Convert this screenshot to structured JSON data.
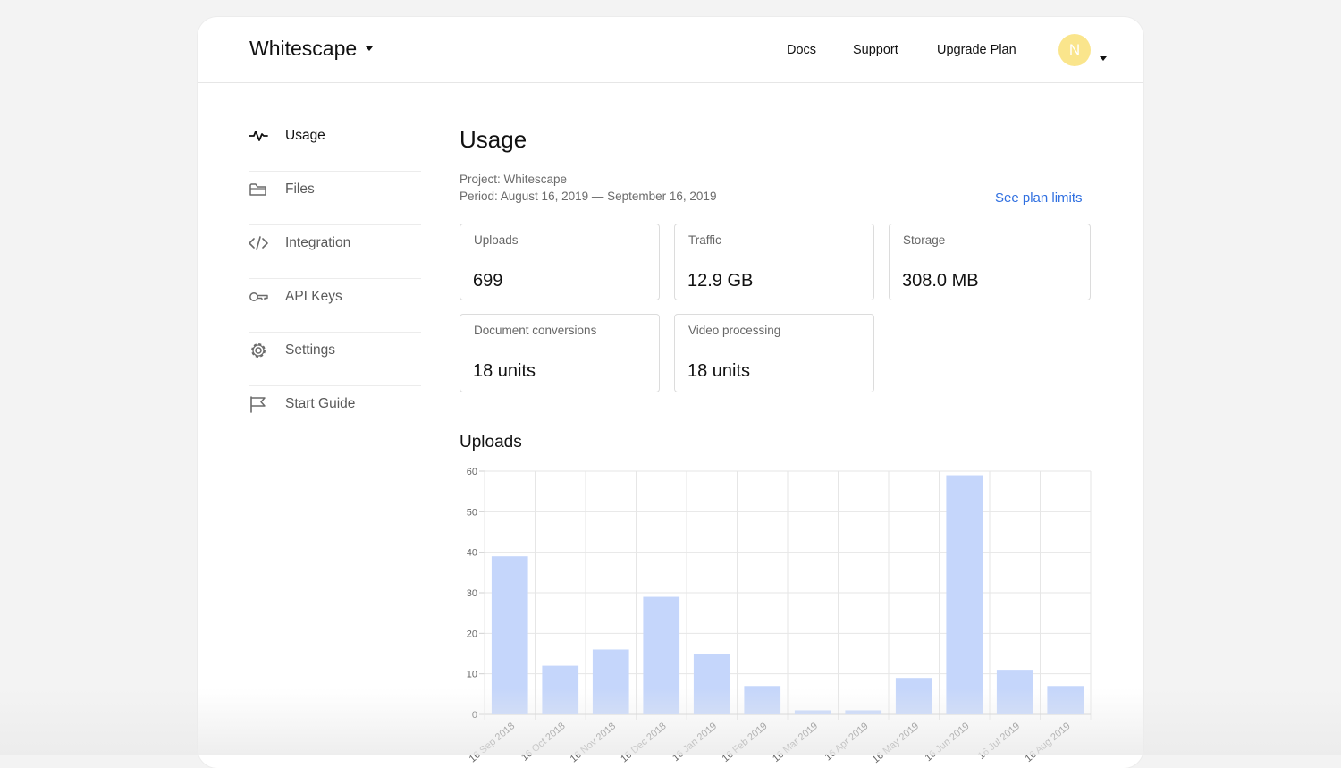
{
  "header": {
    "brand": "Whitescape",
    "links": [
      "Docs",
      "Support",
      "Upgrade Plan"
    ],
    "avatar_initial": "N",
    "avatar_color": "#fae58c"
  },
  "sidebar": {
    "items": [
      {
        "label": "Usage",
        "icon": "activity-icon",
        "active": true
      },
      {
        "label": "Files",
        "icon": "folder-icon",
        "active": false
      },
      {
        "label": "Integration",
        "icon": "code-icon",
        "active": false
      },
      {
        "label": "API Keys",
        "icon": "key-icon",
        "active": false
      },
      {
        "label": "Settings",
        "icon": "gear-icon",
        "active": false
      },
      {
        "label": "Start Guide",
        "icon": "flag-icon",
        "active": false
      }
    ]
  },
  "main": {
    "title": "Usage",
    "project": "Project: Whitescape",
    "period": "Period: August 16, 2019 — September 16, 2019",
    "plan_link": "See plan limits",
    "link_color": "#2f6fe0",
    "stats": [
      {
        "label": "Uploads",
        "value": "699"
      },
      {
        "label": "Traffic",
        "value": "12.9 GB"
      },
      {
        "label": "Storage",
        "value": "308.0 MB"
      },
      {
        "label": "Document conversions",
        "value": "18 units"
      },
      {
        "label": "Video processing",
        "value": "18 units"
      }
    ],
    "chart_heading": "Uploads"
  },
  "chart_data": {
    "type": "bar",
    "title": "Uploads",
    "categories": [
      "16 Sep 2018",
      "16 Oct 2018",
      "16 Nov 2018",
      "16 Dec 2018",
      "16 Jan 2019",
      "16 Feb 2019",
      "16 Mar 2019",
      "16 Apr 2019",
      "16 May 2019",
      "16 Jun 2019",
      "16 Jul 2019",
      "16 Aug 2019"
    ],
    "values": [
      39,
      12,
      16,
      29,
      15,
      7,
      1,
      1,
      9,
      59,
      11,
      7
    ],
    "ylim": [
      0,
      60
    ],
    "yticks": [
      0,
      10,
      20,
      30,
      40,
      50,
      60
    ],
    "grid": true,
    "bar_color": "#c5d6fb"
  }
}
